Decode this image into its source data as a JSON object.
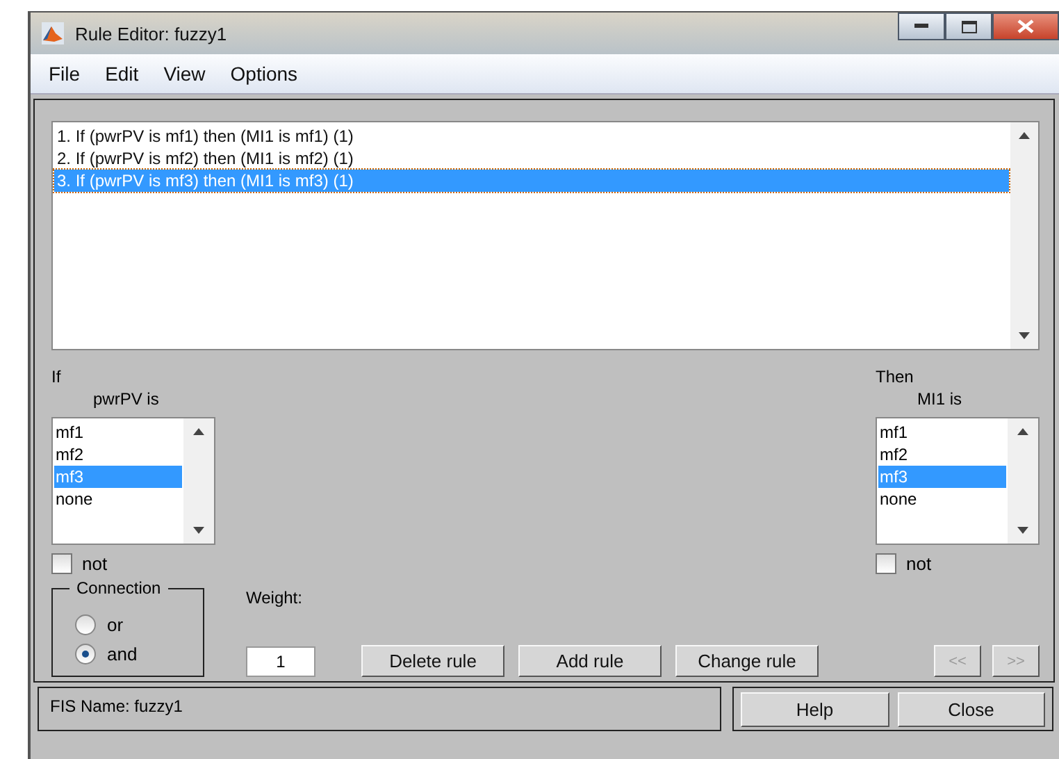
{
  "window": {
    "title": "Rule Editor: fuzzy1"
  },
  "menu": [
    {
      "label": "File"
    },
    {
      "label": "Edit"
    },
    {
      "label": "View"
    },
    {
      "label": "Options"
    }
  ],
  "rules": [
    {
      "text": "1. If (pwrPV is mf1) then (MI1 is mf1) (1)",
      "selected": false
    },
    {
      "text": "2. If (pwrPV is mf2) then (MI1 is mf2) (1)",
      "selected": false
    },
    {
      "text": "3. If (pwrPV is mf3) then (MI1 is mf3) (1)",
      "selected": true
    }
  ],
  "if": {
    "label": "If",
    "variable": "pwrPV is",
    "items": [
      {
        "label": "mf1",
        "selected": false
      },
      {
        "label": "mf2",
        "selected": false
      },
      {
        "label": "mf3",
        "selected": true
      },
      {
        "label": "none",
        "selected": false
      }
    ],
    "not": {
      "label": "not",
      "checked": false
    }
  },
  "then": {
    "label": "Then",
    "variable": "MI1 is",
    "items": [
      {
        "label": "mf1",
        "selected": false
      },
      {
        "label": "mf2",
        "selected": false
      },
      {
        "label": "mf3",
        "selected": true
      },
      {
        "label": "none",
        "selected": false
      }
    ],
    "not": {
      "label": "not",
      "checked": false
    }
  },
  "connection": {
    "title": "Connection",
    "options": [
      {
        "label": "or",
        "selected": false
      },
      {
        "label": "and",
        "selected": true
      }
    ]
  },
  "weight": {
    "label": "Weight:",
    "value": "1"
  },
  "rule_buttons": [
    {
      "label": "Delete rule",
      "disabled": false
    },
    {
      "label": "Add rule",
      "disabled": false
    },
    {
      "label": "Change rule",
      "disabled": false
    }
  ],
  "nav_buttons": [
    {
      "label": "<<",
      "disabled": true
    },
    {
      "label": ">>",
      "disabled": true
    }
  ],
  "status": "FIS Name: fuzzy1",
  "footer_buttons": [
    {
      "label": "Help"
    },
    {
      "label": "Close"
    }
  ]
}
